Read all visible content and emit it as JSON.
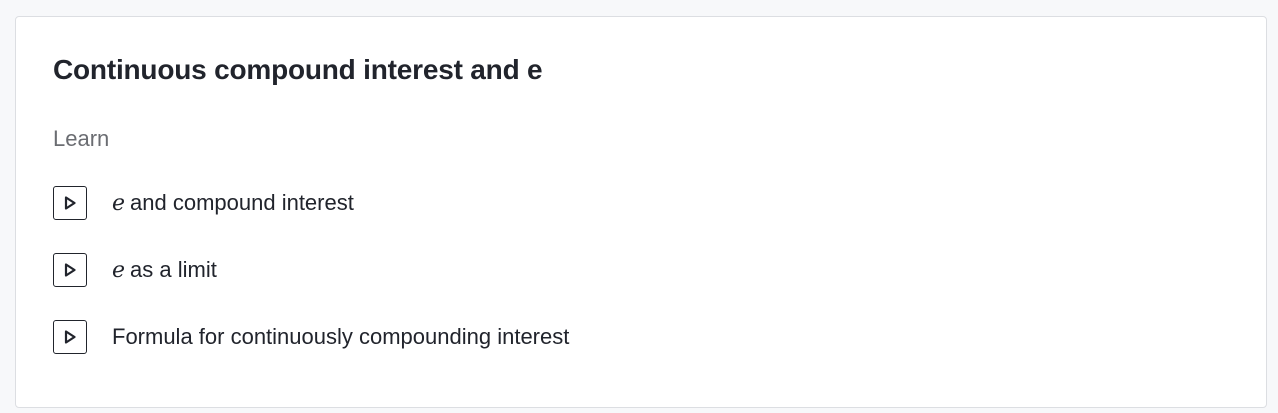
{
  "card": {
    "title": "Continuous compound interest and e",
    "section_label": "Learn",
    "lessons": [
      {
        "math": "e",
        "label": "and compound interest",
        "icon": "play-icon"
      },
      {
        "math": "e",
        "label": "as a limit",
        "icon": "play-icon"
      },
      {
        "math": "",
        "label": "Formula for continuously compounding interest",
        "icon": "play-icon"
      }
    ]
  }
}
